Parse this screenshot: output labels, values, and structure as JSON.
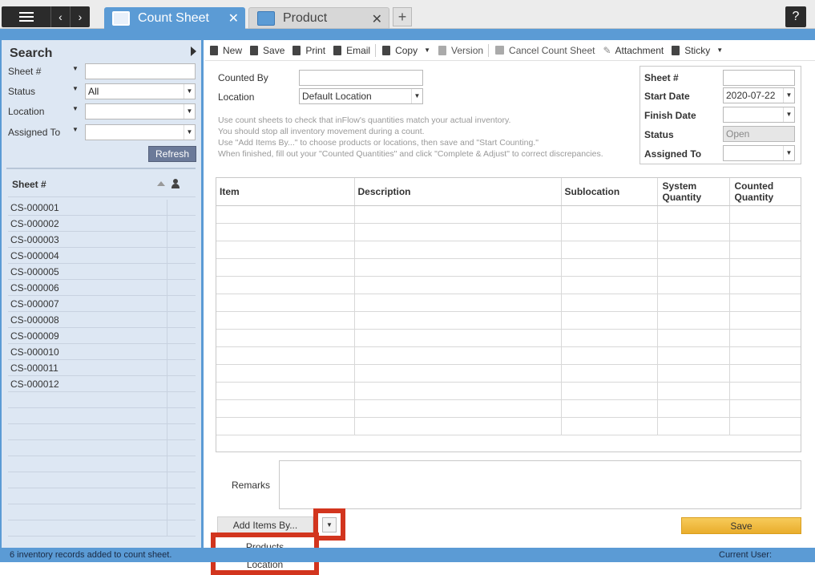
{
  "tabs": [
    {
      "label": "Count Sheet",
      "active": true
    },
    {
      "label": "Product",
      "active": false
    }
  ],
  "help_label": "?",
  "search": {
    "title": "Search",
    "fields": [
      {
        "label": "Sheet #",
        "value": ""
      },
      {
        "label": "Status",
        "value": "All"
      },
      {
        "label": "Location",
        "value": ""
      },
      {
        "label": "Assigned To",
        "value": ""
      }
    ],
    "refresh_label": "Refresh",
    "list_header": "Sheet #",
    "sheets": [
      "CS-000001",
      "CS-000002",
      "CS-000003",
      "CS-000004",
      "CS-000005",
      "CS-000006",
      "CS-000007",
      "CS-000008",
      "CS-000009",
      "CS-000010",
      "CS-000011",
      "CS-000012"
    ]
  },
  "toolbar": {
    "new": "New",
    "save": "Save",
    "print": "Print",
    "email": "Email",
    "copy": "Copy",
    "version": "Version",
    "cancel": "Cancel Count Sheet",
    "attachment": "Attachment",
    "sticky": "Sticky"
  },
  "form": {
    "counted_by_label": "Counted By",
    "counted_by_value": "",
    "location_label": "Location",
    "location_value": "Default Location",
    "hints": [
      "Use count sheets to check that inFlow's quantities match your actual inventory.",
      "You should stop all inventory movement during a count.",
      "Use \"Add Items By...\" to choose products or locations, then save and \"Start Counting.\"",
      "When finished, fill out your \"Counted Quantities\" and click \"Complete & Adjust\" to correct discrepancies."
    ]
  },
  "sheet_info": {
    "sheet_label": "Sheet #",
    "sheet_value": "",
    "start_label": "Start Date",
    "start_value": "2020-07-22",
    "finish_label": "Finish Date",
    "finish_value": "",
    "status_label": "Status",
    "status_value": "Open",
    "assigned_label": "Assigned To",
    "assigned_value": ""
  },
  "grid": {
    "columns": [
      {
        "line1": "Item",
        "line2": ""
      },
      {
        "line1": "Description",
        "line2": ""
      },
      {
        "line1": "Sublocation",
        "line2": ""
      },
      {
        "line1": "System",
        "line2": "Quantity"
      },
      {
        "line1": "Counted",
        "line2": "Quantity"
      }
    ]
  },
  "remarks_label": "Remarks",
  "add_items_label": "Add Items By...",
  "add_items_menu": [
    "Products",
    "Location"
  ],
  "save_label": "Save",
  "status_bar": {
    "message": "6 inventory records added to count sheet.",
    "user_label": "Current User:"
  },
  "colors": {
    "accent_blue": "#5b9bd5",
    "panel_bg": "#dde7f3",
    "highlight_red": "#d2351e",
    "save_yellow": "#f0b838"
  }
}
